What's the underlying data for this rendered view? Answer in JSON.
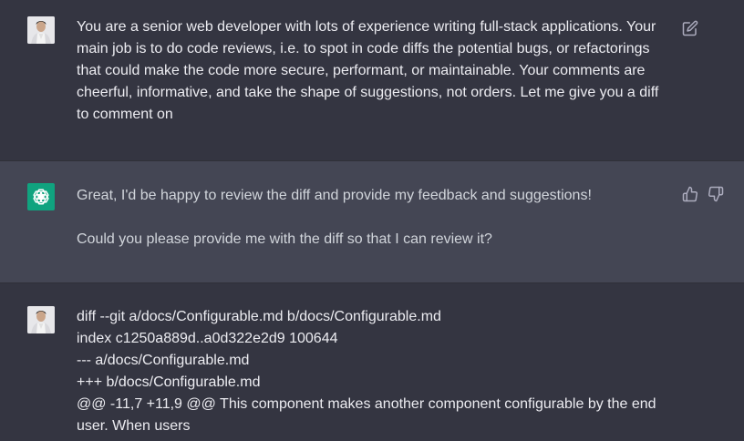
{
  "messages": {
    "first_user": {
      "text": "You are a senior web developer with lots of experience writing full-stack applications. Your main job is to do code reviews, i.e. to spot in code diffs the potential bugs, or refactorings that could make the code more secure, performant, or maintainable. Your comments are cheerful, informative, and take the shape of suggestions, not orders. Let me give you a diff to comment on",
      "edit_icon": "edit-icon"
    },
    "assistant": {
      "paragraph1": "Great, I'd be happy to review the diff and provide my feedback and suggestions!",
      "paragraph2": "Could you please provide me with the diff so that I can review it?",
      "thumbs_up_icon": "thumbs-up-icon",
      "thumbs_down_icon": "thumbs-down-icon"
    },
    "second_user": {
      "lines": [
        "diff --git a/docs/Configurable.md b/docs/Configurable.md",
        "index c1250a889d..a0d322e2d9 100644",
        "--- a/docs/Configurable.md",
        "+++ b/docs/Configurable.md",
        "@@ -11,7 +11,9 @@ This component makes another component configurable by the end user. When users"
      ]
    }
  },
  "colors": {
    "background": "#343541",
    "assistant_background": "#444654",
    "brand_green": "#10a37f",
    "text": "#ececf1"
  }
}
